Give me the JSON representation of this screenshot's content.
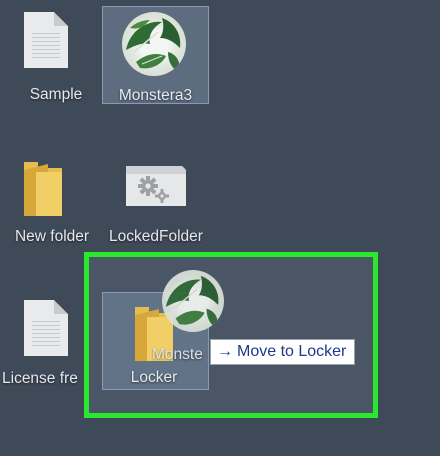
{
  "desktop": {
    "icons": [
      {
        "label": "Sample",
        "icon": "text-file-icon"
      },
      {
        "label": "Monstera3",
        "icon": "monstera-image-thumbnail-icon"
      },
      {
        "label": "New folder",
        "icon": "folder-icon"
      },
      {
        "label": "LockedFolder",
        "icon": "gear-folder-icon"
      },
      {
        "label": "License fre",
        "icon": "text-file-icon"
      },
      {
        "label": "Locker",
        "icon": "folder-icon"
      }
    ]
  },
  "drag": {
    "ghost_label": "Monste",
    "tooltip_text": "Move to Locker",
    "tooltip_icon": "arrow-right-icon"
  },
  "colors": {
    "desktop_background": "#3f4a58",
    "highlight_border": "#29e82e",
    "tooltip_text": "#1b3a8a"
  }
}
